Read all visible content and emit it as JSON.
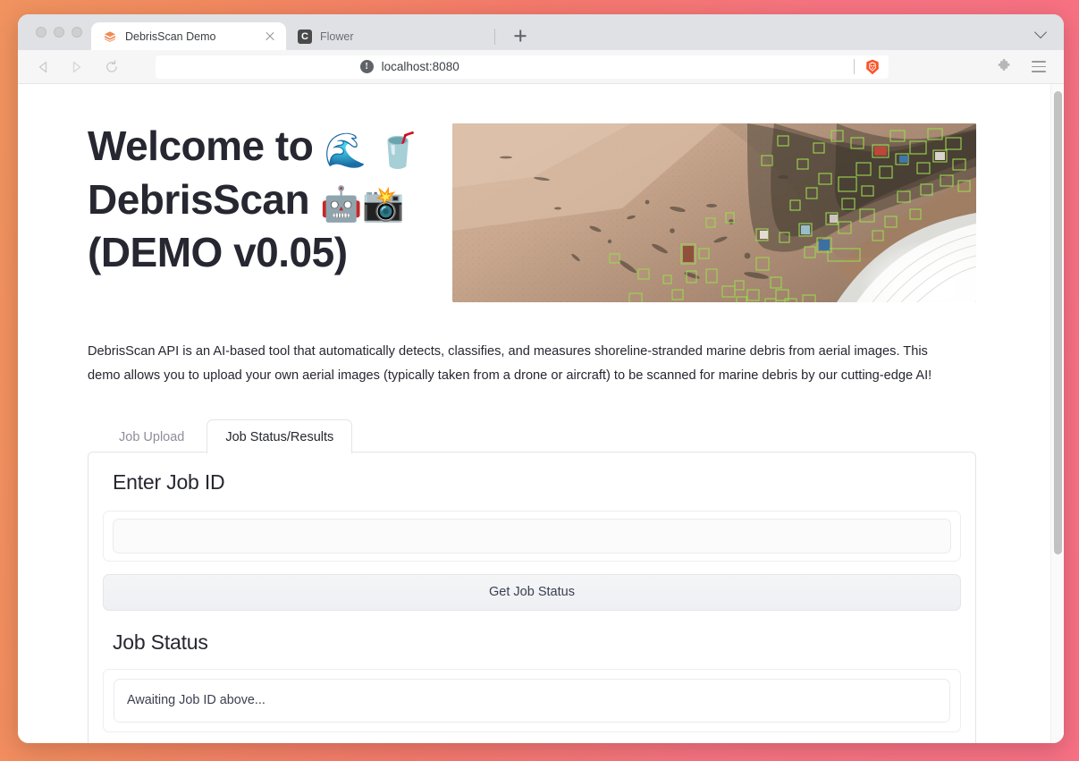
{
  "browser": {
    "name": "Brave",
    "tabs": [
      {
        "title": "DebrisScan Demo",
        "favicon": "debrisscan-hex-icon",
        "active": true
      },
      {
        "title": "Flower",
        "favicon": "letter-c-icon",
        "active": false
      }
    ],
    "new_tab_label": "+",
    "tabstrip_menu_icon": "chevron-down-icon",
    "nav": {
      "back_icon": "back-arrow-icon",
      "forward_icon": "forward-arrow-icon",
      "reload_icon": "reload-icon"
    },
    "url_bar": {
      "security_icon": "not-secure-icon",
      "security_glyph": "!",
      "url": "localhost:8080"
    },
    "shield_icon": "brave-lion-icon",
    "extensions_icon": "puzzle-piece-icon",
    "menu_icon": "hamburger-menu-icon",
    "window_controls": [
      "close",
      "minimize",
      "maximize"
    ]
  },
  "page": {
    "hero": {
      "title_line1": "Welcome to",
      "title_emoji1": "🌊",
      "title_emoji2": "🥤",
      "title_line2": "DebrisScan",
      "title_emoji3": "🤖",
      "title_emoji4": "📸",
      "title_line3": "(DEMO v0.05)",
      "image_alt": "aerial-beach-debris-detection-image"
    },
    "description": "DebrisScan API is an AI-based tool that automatically detects, classifies, and measures shoreline-stranded marine debris from aerial images. This demo allows you to upload your own aerial images (typically taken from a drone or aircraft) to be scanned for marine debris by our cutting-edge AI!",
    "tabs": [
      {
        "label": "Job Upload",
        "active": false
      },
      {
        "label": "Job Status/Results",
        "active": true
      }
    ],
    "job_status_panel": {
      "heading": "Enter Job ID",
      "job_id_value": "",
      "job_id_placeholder": "",
      "submit_label": "Get Job Status",
      "status_heading": "Job Status",
      "status_text": "Awaiting Job ID above..."
    }
  },
  "theme": {
    "page_bg_start": "#f0935f",
    "page_bg_end": "#f77084",
    "brave_orange": "#fb542b",
    "detection_box_green": "#8fd14f",
    "text_primary": "#262730",
    "text_muted": "#8e8e9a"
  }
}
